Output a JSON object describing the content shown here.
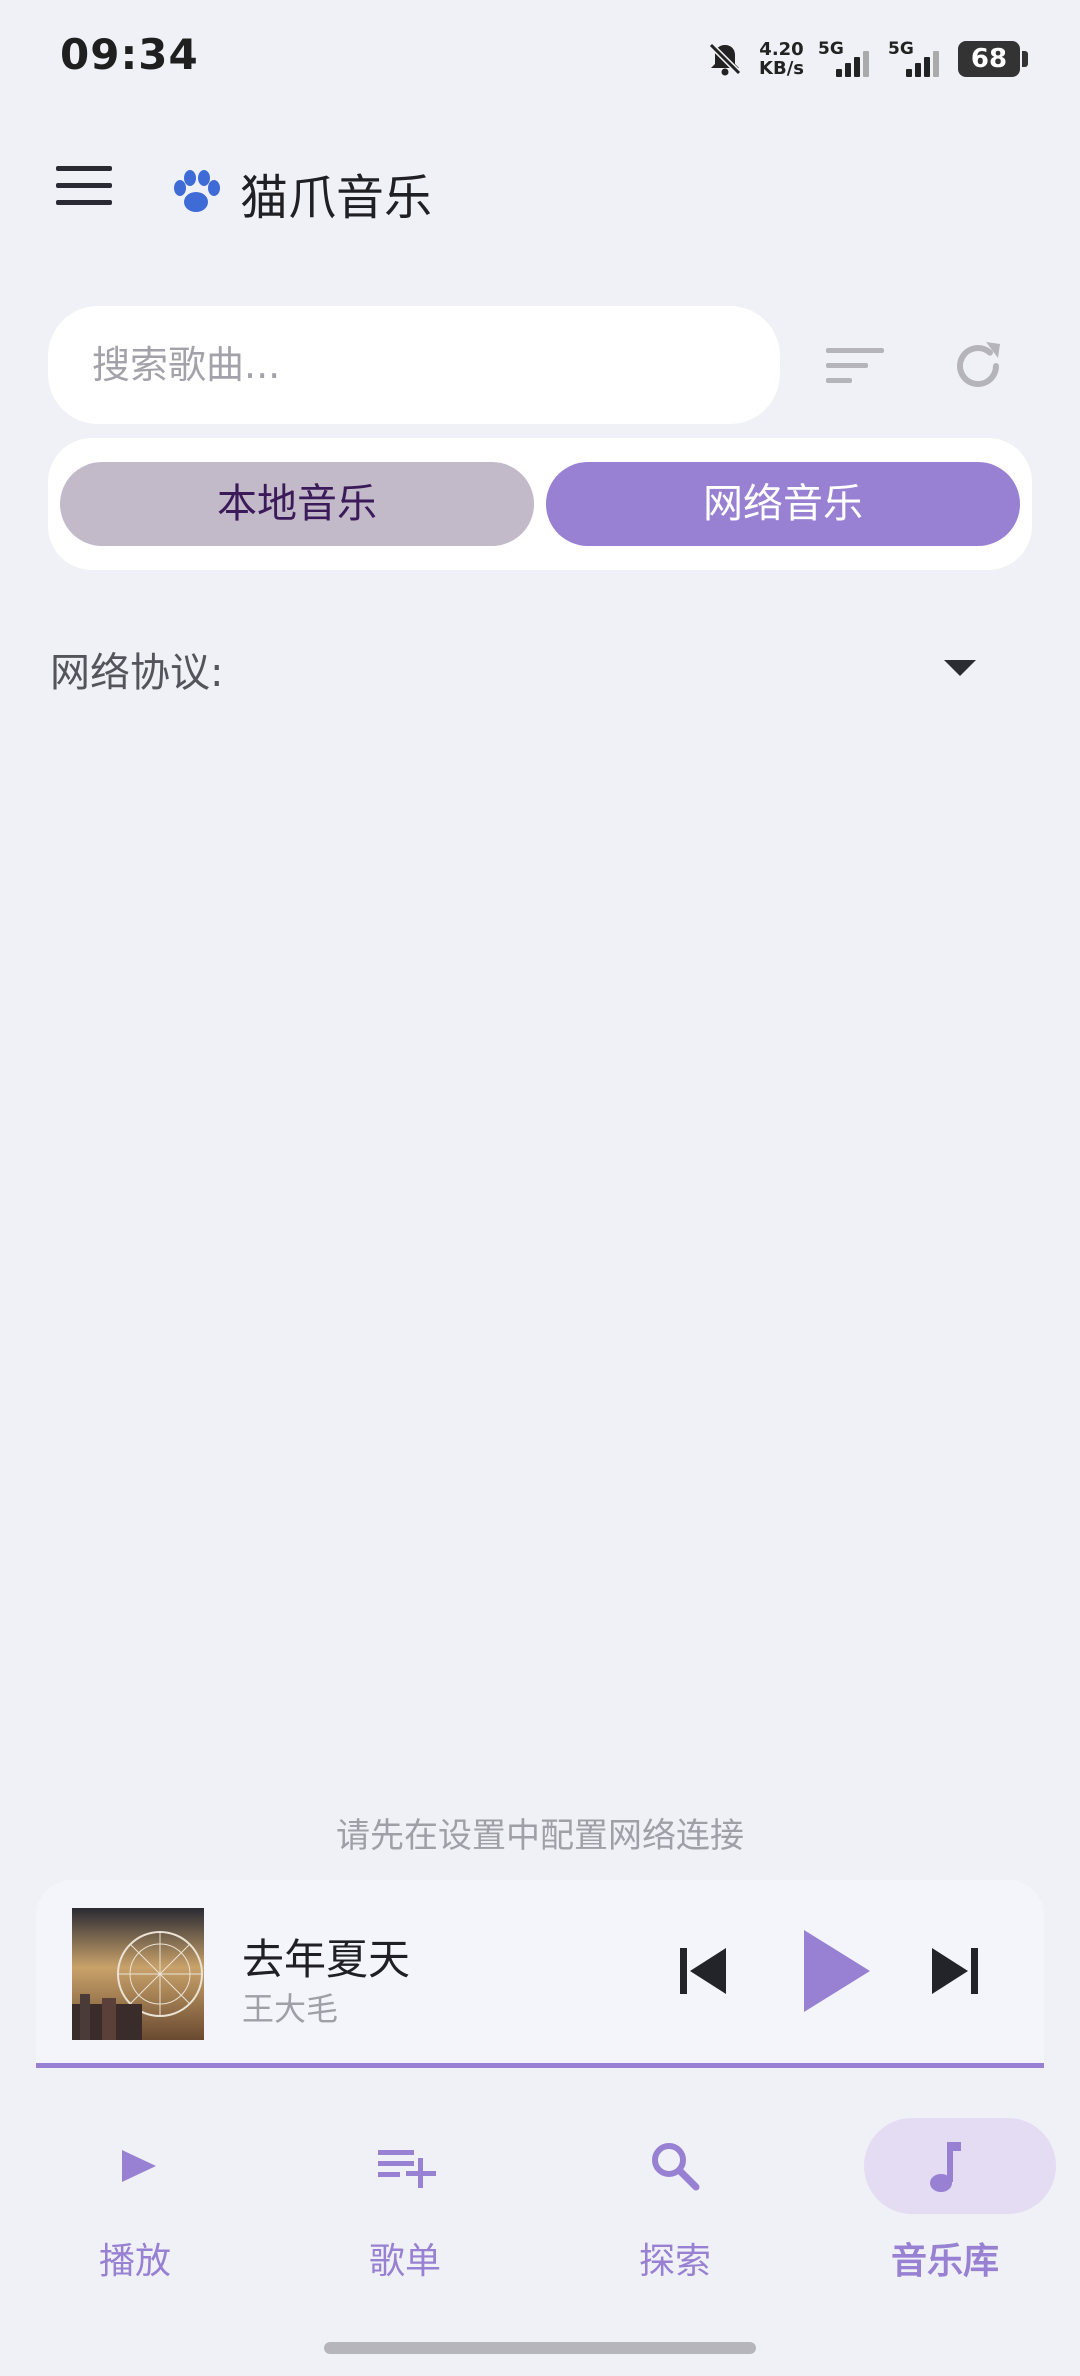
{
  "status_bar": {
    "time": "09:34",
    "net_speed_value": "4.20",
    "net_speed_unit": "KB/s",
    "signal_1": "5G",
    "signal_2": "5G",
    "battery": "68",
    "icons": [
      "bell-off-icon",
      "signal-icon",
      "battery-icon"
    ]
  },
  "app_bar": {
    "icon": "paw-icon",
    "title": "猫爪音乐"
  },
  "search": {
    "placeholder": "搜索歌曲...",
    "value": ""
  },
  "segments": {
    "local": "本地音乐",
    "network": "网络音乐",
    "selected": "network"
  },
  "protocol": {
    "label": "网络协议:",
    "value": ""
  },
  "hint": "请先在设置中配置网络连接",
  "player": {
    "title": "去年夏天",
    "artist": "王大毛",
    "icons": [
      "skip-previous-icon",
      "play-icon",
      "skip-next-icon"
    ]
  },
  "bottom_nav": {
    "items": [
      {
        "label": "播放",
        "icon": "play-icon"
      },
      {
        "label": "歌单",
        "icon": "playlist-add-icon"
      },
      {
        "label": "探索",
        "icon": "search-icon"
      },
      {
        "label": "音乐库",
        "icon": "music-note-icon"
      }
    ],
    "active_index": 3
  },
  "colors": {
    "accent": "#9880d3",
    "background": "#f0f1f6",
    "segment_inactive": "#c2b9c9"
  }
}
